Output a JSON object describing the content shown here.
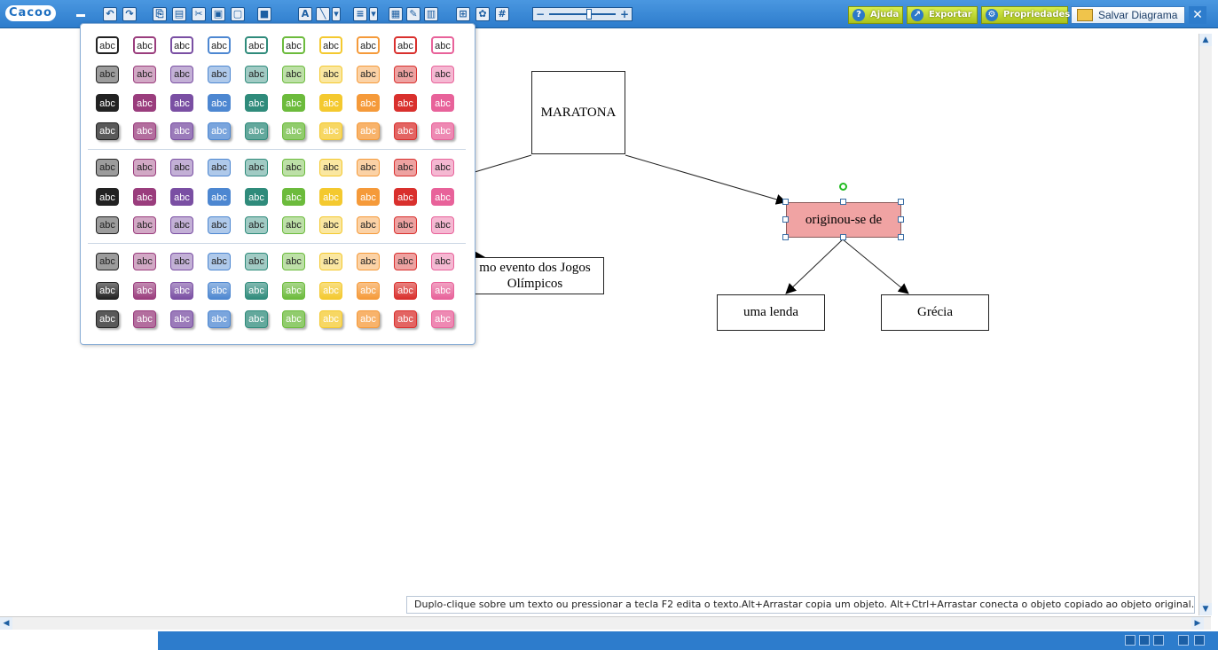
{
  "toolbar": {
    "logo": "Cacoo",
    "buttons": {
      "help": "Ajuda",
      "export": "Exportar",
      "properties": "Propriedades",
      "save": "Salvar Diagrama"
    }
  },
  "diagram": {
    "nodes": {
      "maratona": "MARATONA",
      "originou": "originou-se de",
      "jogos": "mo evento dos Jogos Olímpicos",
      "lenda": "uma lenda",
      "grecia": "Grécia"
    }
  },
  "palette": {
    "swatch_label": "abc",
    "colors": [
      "#222222",
      "#9a3d7d",
      "#7a4fa3",
      "#4d87d1",
      "#2f8b7b",
      "#6cbb3c",
      "#f4c92f",
      "#f59a3a",
      "#d9302d",
      "#e8629a"
    ]
  },
  "status": {
    "hint": "Duplo-clique sobre um texto ou pressionar a tecla F2 edita o texto.Alt+Arrastar copia um objeto. Alt+Ctrl+Arrastar conecta o objeto copiado ao objeto original."
  }
}
